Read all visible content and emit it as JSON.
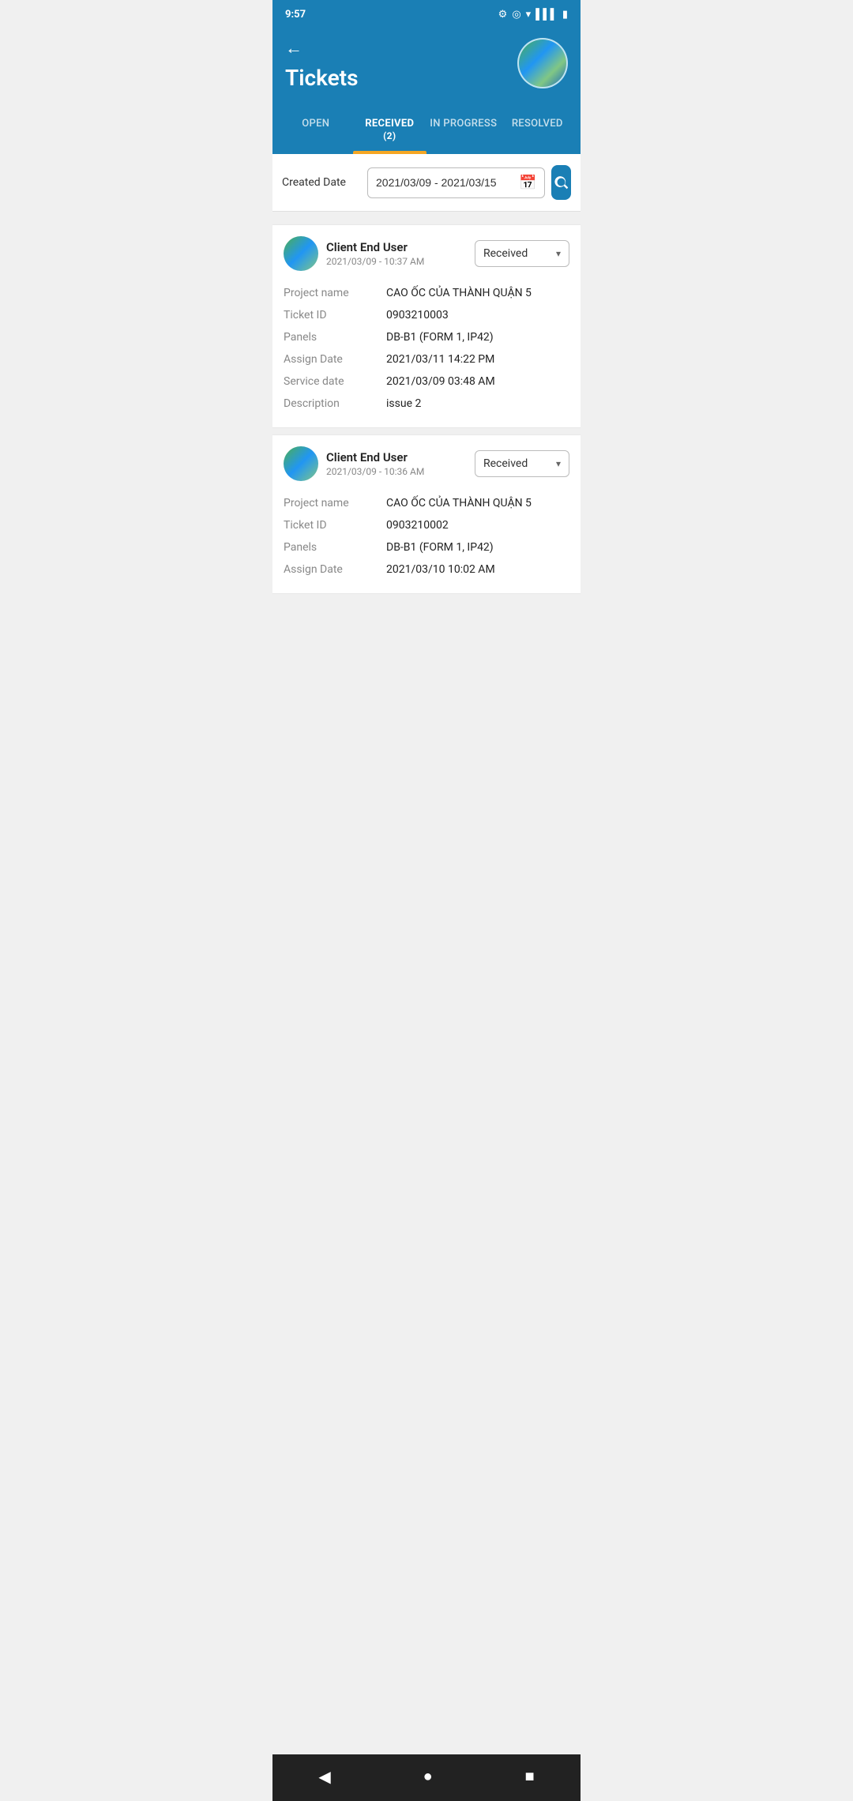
{
  "statusBar": {
    "time": "9:57",
    "icons": [
      "settings",
      "location",
      "wifi",
      "signal",
      "battery"
    ]
  },
  "header": {
    "backLabel": "←",
    "title": "Tickets"
  },
  "tabs": [
    {
      "id": "open",
      "label": "OPEN",
      "badge": null,
      "active": false
    },
    {
      "id": "received",
      "label": "RECEIVED",
      "badge": "(2)",
      "active": true
    },
    {
      "id": "in_progress",
      "label": "IN PROGRESS",
      "badge": null,
      "active": false
    },
    {
      "id": "resolved",
      "label": "RESOLVED",
      "badge": null,
      "active": false
    }
  ],
  "filter": {
    "label": "Created Date",
    "dateValue": "2021/03/09 - 2021/03/15",
    "searchLabel": "Search"
  },
  "tickets": [
    {
      "id": "ticket-1",
      "user": {
        "name": "Client End User",
        "date": "2021/03/09 - 10:37 AM"
      },
      "status": "Received",
      "details": {
        "projectName": {
          "label": "Project name",
          "value": "CAO ỐC CỦA THÀNH QUẬN 5"
        },
        "ticketId": {
          "label": "Ticket ID",
          "value": "0903210003"
        },
        "panels": {
          "label": "Panels",
          "value": "DB-B1 (FORM 1, IP42)"
        },
        "assignDate": {
          "label": "Assign Date",
          "value": "2021/03/11 14:22 PM"
        },
        "serviceDate": {
          "label": "Service date",
          "value": "2021/03/09 03:48 AM"
        },
        "description": {
          "label": "Description",
          "value": "issue 2"
        }
      }
    },
    {
      "id": "ticket-2",
      "user": {
        "name": "Client End User",
        "date": "2021/03/09 - 10:36 AM"
      },
      "status": "Received",
      "details": {
        "projectName": {
          "label": "Project name",
          "value": "CAO ỐC CỦA THÀNH QUẬN 5"
        },
        "ticketId": {
          "label": "Ticket ID",
          "value": "0903210002"
        },
        "panels": {
          "label": "Panels",
          "value": "DB-B1 (FORM 1, IP42)"
        },
        "assignDate": {
          "label": "Assign Date",
          "value": "2021/03/10 10:02 AM"
        }
      }
    }
  ],
  "bottomNav": {
    "back": "◀",
    "home": "●",
    "recent": "■"
  },
  "colors": {
    "primary": "#1a7fb5",
    "accent": "#f5a623",
    "textPrimary": "#222",
    "textSecondary": "#888"
  }
}
